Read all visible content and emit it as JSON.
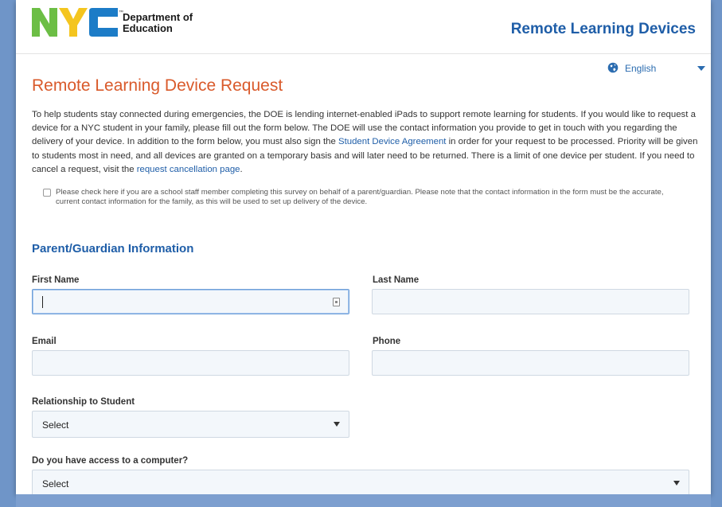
{
  "header": {
    "logo_letters": "NYC",
    "logo_line1": "Department of",
    "logo_line2": "Education",
    "site_title": "Remote Learning Devices"
  },
  "language": {
    "selected": "English",
    "icon": "globe-icon"
  },
  "page_title": "Remote Learning Device Request",
  "intro": {
    "text_before_link1": "To help students stay connected during emergencies, the DOE is lending internet-enabled iPads to support remote learning for students. If you would like to request a device for a NYC student in your family, please fill out the form below. The DOE will use the contact information you provide to get in touch with you regarding the delivery of your device. In addition to the form below, you must also sign the ",
    "link1": "Student Device Agreement",
    "text_between": " in order for your request to be processed. Priority will be given to students most in need, and all devices are granted on a temporary basis and will later need to be returned. There is a limit of one device per student. If you need to cancel a request, visit the ",
    "link2": "request cancellation page",
    "text_after": "."
  },
  "staff_checkbox": {
    "checked": false,
    "label": "Please check here if you are a school staff member completing this survey on behalf of a parent/guardian. Please note that the contact information in the form must be the accurate, current contact information for the family, as this will be used to set up delivery of the device."
  },
  "section": {
    "title": "Parent/Guardian Information"
  },
  "fields": {
    "first_name": {
      "label": "First Name",
      "value": ""
    },
    "last_name": {
      "label": "Last Name",
      "value": ""
    },
    "email": {
      "label": "Email",
      "value": ""
    },
    "phone": {
      "label": "Phone",
      "value": ""
    },
    "relationship": {
      "label": "Relationship to Student",
      "value": "Select"
    },
    "computer_access": {
      "label": "Do you have access to a computer?",
      "value": "Select"
    }
  },
  "colors": {
    "accent_blue": "#1f5ea8",
    "title_orange": "#d95a2b",
    "logo_green": "#6cbe45",
    "logo_yellow": "#f4c51f",
    "logo_blue": "#1c7cc7",
    "background": "#6f95c8"
  }
}
